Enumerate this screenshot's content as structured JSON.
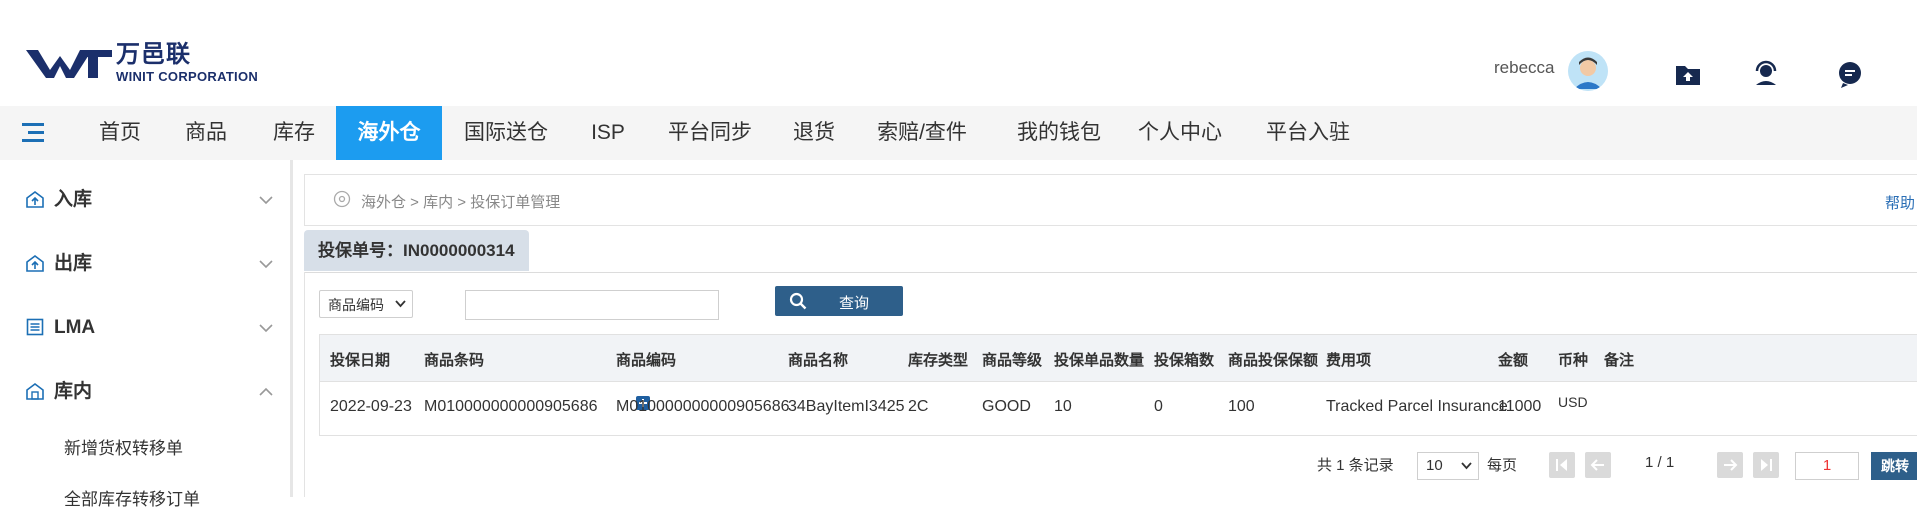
{
  "brand": {
    "logo_cn": "万邑联",
    "logo_en": "WINIT CORPORATION",
    "colors": {
      "primary": "#1c9cf0",
      "dark": "#2e5f8a",
      "navy": "#1b2f6b"
    }
  },
  "header": {
    "username": "rebecca",
    "icons": [
      "avatar",
      "folder-upload-icon",
      "support-icon",
      "message-icon"
    ]
  },
  "nav": {
    "items": [
      "首页",
      "商品",
      "库存",
      "海外仓",
      "国际送仓",
      "ISP",
      "平台同步",
      "退货",
      "索赔/查件",
      "我的钱包",
      "个人中心",
      "平台入驻"
    ],
    "active": "海外仓"
  },
  "sidebar": {
    "groups": [
      {
        "label": "入库",
        "expanded": false
      },
      {
        "label": "出库",
        "expanded": false
      },
      {
        "label": "LMA",
        "expanded": false
      },
      {
        "label": "库内",
        "expanded": true
      }
    ],
    "subitems": [
      "新增货权转移单",
      "全部库存转移订单"
    ]
  },
  "breadcrumb": {
    "text": "海外仓 > 库内 > 投保订单管理",
    "help": "帮助"
  },
  "tab": {
    "label": "投保单号：IN0000000314"
  },
  "search": {
    "field_select": "商品编码",
    "input_value": "",
    "button": "查询"
  },
  "table": {
    "headers": [
      "投保日期",
      "商品条码",
      "商品编码",
      "商品名称",
      "库存类型",
      "商品等级",
      "投保单品数量",
      "投保箱数",
      "商品投保保额",
      "费用项",
      "金额",
      "币种",
      "备注"
    ],
    "rows": [
      [
        "2022-09-23",
        "M010000000000905686",
        "M010000000000905686",
        "34BayItemI3425",
        "2C",
        "GOOD",
        "10",
        "0",
        "100",
        "Tracked Parcel Insurance",
        "11000",
        "USD",
        ""
      ]
    ]
  },
  "pager": {
    "total_text": "共 1 条记录",
    "page_size": "10",
    "per_page_label": "每页",
    "page_status": "1 / 1",
    "page_input": "1",
    "jump_label": "跳转"
  }
}
